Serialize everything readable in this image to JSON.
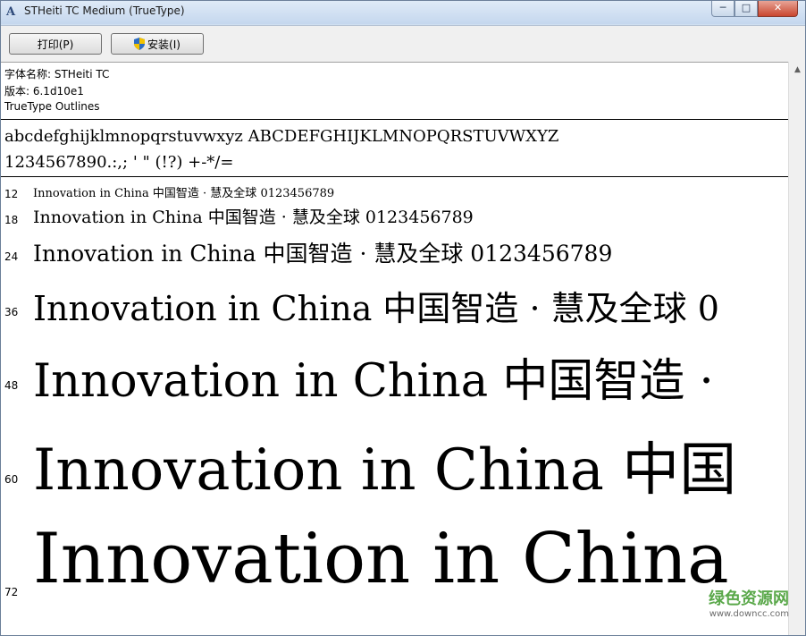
{
  "window": {
    "title": "STHeiti TC Medium (TrueType)",
    "minimize_glyph": "─",
    "maximize_glyph": "□",
    "close_glyph": "✕"
  },
  "toolbar": {
    "print_label": "打印(P)",
    "install_label": "安装(I)"
  },
  "info": {
    "font_name": "字体名称: STHeiti TC",
    "version": "版本: 6.1d10e1",
    "outline_type": "TrueType Outlines"
  },
  "charset": {
    "line1": "abcdefghijklmnopqrstuvwxyz ABCDEFGHIJKLMNOPQRSTUVWXYZ",
    "line2": "1234567890.:,; ' \" (!?) +-*/="
  },
  "samples": [
    {
      "size": "12",
      "text": "Innovation in China 中国智造 · 慧及全球 0123456789"
    },
    {
      "size": "18",
      "text": "Innovation in China 中国智造 · 慧及全球 0123456789"
    },
    {
      "size": "24",
      "text": "Innovation in China 中国智造 · 慧及全球 0123456789"
    },
    {
      "size": "36",
      "text": "Innovation in China 中国智造 · 慧及全球 0"
    },
    {
      "size": "48",
      "text": "Innovation in China 中国智造 ·"
    },
    {
      "size": "60",
      "text": "Innovation in China 中国"
    },
    {
      "size": "72",
      "text": "Innovation in China"
    }
  ],
  "watermark": {
    "main": "绿色资源网",
    "sub": "www.downcc.com"
  },
  "icons": {
    "app": "font-viewer-icon",
    "install": "shield-icon"
  }
}
